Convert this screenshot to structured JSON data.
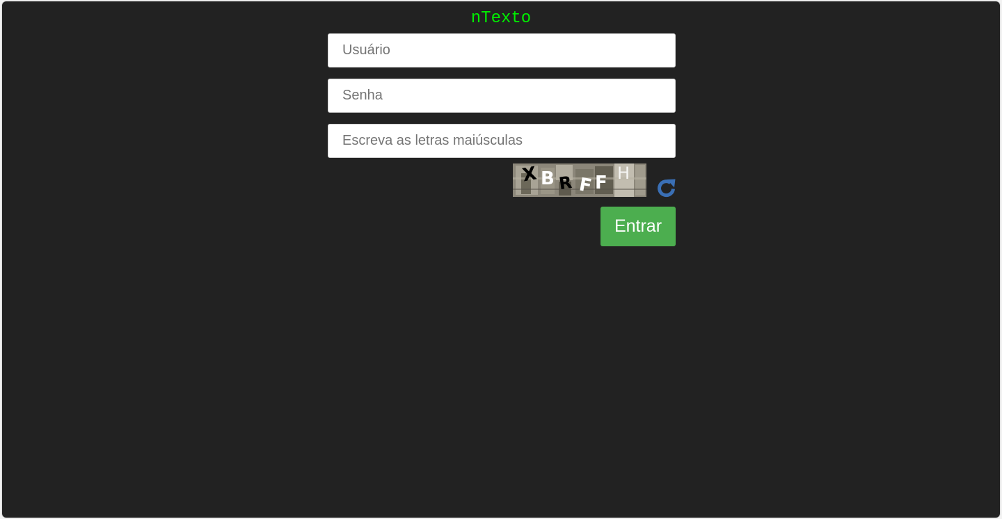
{
  "app": {
    "brand_title": "nTexto",
    "brand_color": "#00ee00",
    "background_color": "#222222"
  },
  "login_form": {
    "username": {
      "placeholder": "Usuário",
      "value": ""
    },
    "password": {
      "placeholder": "Senha",
      "value": ""
    },
    "captcha_input": {
      "placeholder": "Escreva as letras maiúsculas",
      "value": ""
    },
    "captcha_image": {
      "letters": [
        "X",
        "B",
        "R",
        "F",
        "F",
        "H"
      ]
    },
    "refresh_icon": "refresh-icon",
    "refresh_color": "#3a6fb5",
    "submit_label": "Entrar",
    "submit_color": "#4cae4f"
  }
}
